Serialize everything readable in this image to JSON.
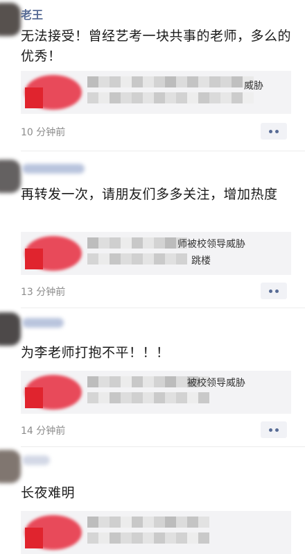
{
  "comments": [
    {
      "author": "老王",
      "content": "无法接受！曾经艺考一块共事的老师，多么的优秀！",
      "link_text": "威胁",
      "link_text_2": "",
      "time": "10 分钟前"
    },
    {
      "author": "",
      "content": "再转发一次，请朋友们多多关注，增加热度",
      "link_text": "师被校领导威胁",
      "link_text_2": "跳楼",
      "time": "13 分钟前"
    },
    {
      "author": "",
      "content": "为李老师打抱不平！！！",
      "link_text": "被校领导威胁",
      "link_text_2": "",
      "time": "14 分钟前"
    },
    {
      "author": "",
      "content": "长夜难明",
      "link_text": "",
      "link_text_2": "",
      "time": ""
    }
  ],
  "colors": {
    "author": "#576b95",
    "thumb_red": "#e0242e",
    "card_bg": "#f3f3f5",
    "time": "#8b8b8b"
  },
  "icons": {
    "more": "more-dots-icon"
  }
}
